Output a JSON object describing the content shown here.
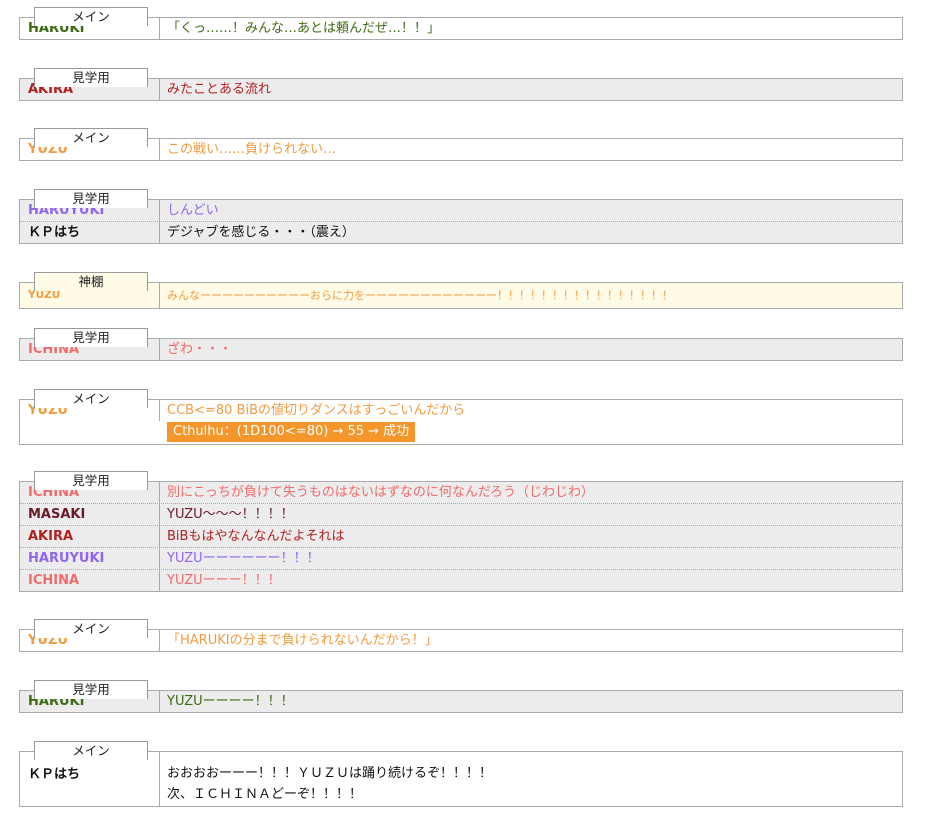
{
  "colors": {
    "HARUKI": "#3d6b14",
    "AKIRA": "#b32020",
    "YUZU": "#f39a3e",
    "HARUYUKI": "#9066f0",
    "KP": "#111111",
    "ICHINA": "#f06b6b",
    "MASAKI": "#6b1a2a",
    "dice_bg": "#f5962a"
  },
  "blocks": [
    {
      "tab": "メイン",
      "rows": [
        {
          "name": "HARUKI",
          "color": "#3d6b14",
          "lines": [
            "「くっ……！みんな…あとは頼んだぜ…！！」"
          ]
        }
      ]
    },
    {
      "tab": "見学用",
      "rows": [
        {
          "name": "AKIRA",
          "color": "#b32020",
          "lines": [
            "みたことある流れ"
          ]
        }
      ]
    },
    {
      "tab": "メイン",
      "rows": [
        {
          "name": "YUZU",
          "color": "#f39a3e",
          "lines": [
            "この戦い……負けられない…"
          ]
        }
      ]
    },
    {
      "tab": "見学用",
      "rows": [
        {
          "name": "HARUYUKI",
          "color": "#9066f0",
          "lines": [
            "しんどい"
          ]
        },
        {
          "name": "ＫＰはち",
          "color": "#111111",
          "lines": [
            "デジャブを感じる・・・（震え）"
          ]
        }
      ]
    },
    {
      "tab": "神棚",
      "rows": [
        {
          "name": "YUZU",
          "color": "#f39a3e",
          "lines": [
            "みんなーーーーーーーーーーおらに力をーーーーーーーーーーーー！！！！！！！！！！！！！！！！"
          ]
        }
      ]
    },
    {
      "tab": "見学用",
      "rows": [
        {
          "name": "ICHINA",
          "color": "#f06b6b",
          "lines": [
            "ざわ・・・"
          ]
        }
      ]
    },
    {
      "tab": "メイン",
      "rows": [
        {
          "name": "YUZU",
          "color": "#f39a3e",
          "lines": [
            "CCB<=80 BiBの値切りダンスはすっごいんだから"
          ],
          "dice": "Cthulhu：(1D100<=80) → 55 → 成功"
        }
      ]
    },
    {
      "tab": "見学用",
      "rows": [
        {
          "name": "ICHINA",
          "color": "#f06b6b",
          "lines": [
            "別にこっちが負けて失うものはないはずなのに何なんだろう（じわじわ）"
          ]
        },
        {
          "name": "MASAKI",
          "color": "#6b1a2a",
          "lines": [
            "YUZU～～～！！！！"
          ]
        },
        {
          "name": "AKIRA",
          "color": "#b32020",
          "lines": [
            "BiBもはやなんなんだよそれは"
          ]
        },
        {
          "name": "HARUYUKI",
          "color": "#9066f0",
          "lines": [
            "YUZUーーーーーー！！！"
          ]
        },
        {
          "name": "ICHINA",
          "color": "#f06b6b",
          "lines": [
            "YUZUーーー！！！"
          ]
        }
      ]
    },
    {
      "tab": "メイン",
      "rows": [
        {
          "name": "YUZU",
          "color": "#f39a3e",
          "lines": [
            "「HARUKIの分まで負けられないんだから！」"
          ]
        }
      ]
    },
    {
      "tab": "見学用",
      "rows": [
        {
          "name": "HARUKI",
          "color": "#3d6b14",
          "lines": [
            "YUZUーーーー！！！"
          ]
        }
      ]
    },
    {
      "tab": "メイン",
      "rows": [
        {
          "name": "ＫＰはち",
          "color": "#111111",
          "lines": [
            "おおおおーーー！！！ＹＵＺＵは踊り続けるぞ！！！！",
            "次、ＩＣＨＩＮＡどーぞ！！！！"
          ]
        }
      ]
    }
  ]
}
